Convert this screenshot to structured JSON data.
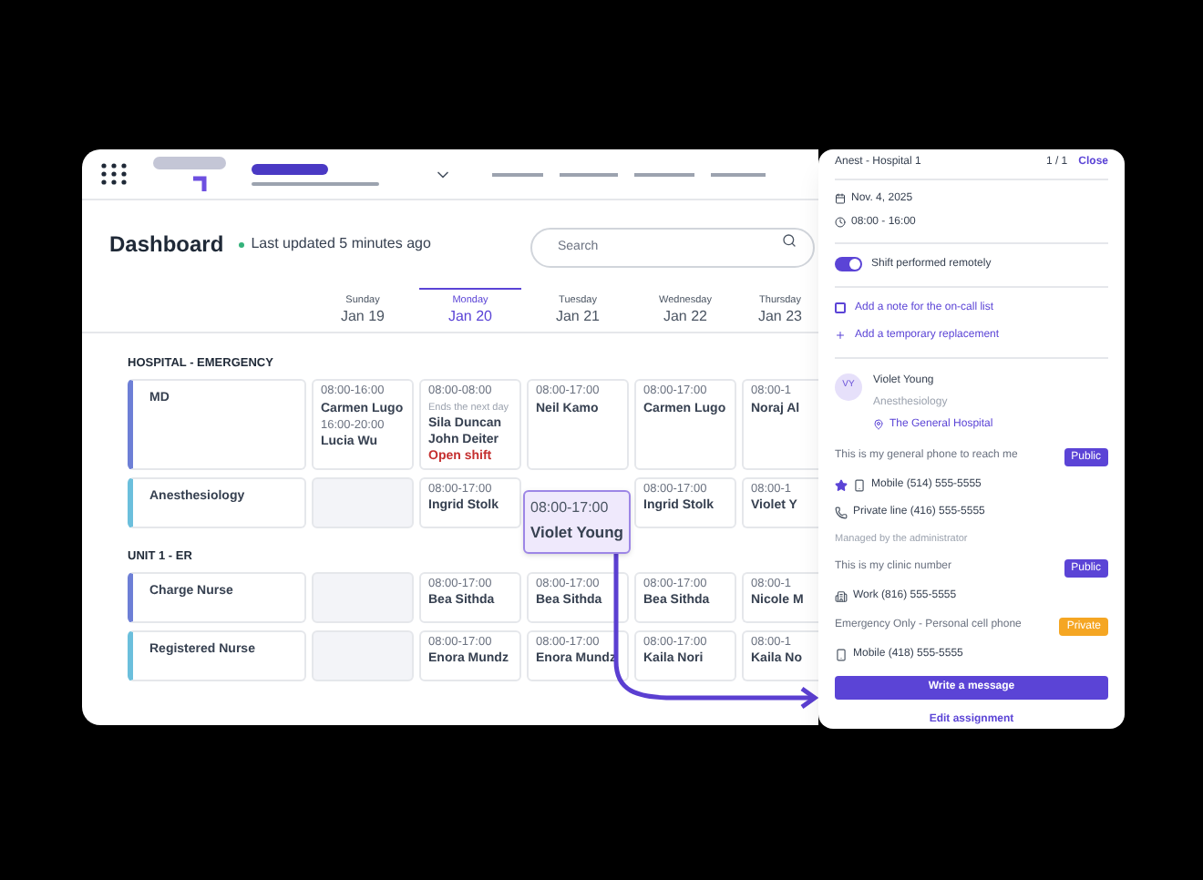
{
  "dashboard": {
    "title": "Dashboard",
    "status": "Last updated 5 minutes ago"
  },
  "search": {
    "placeholder": "Search"
  },
  "days": [
    {
      "weekday": "Sunday",
      "date": "Jan 19",
      "selected": false
    },
    {
      "weekday": "Monday",
      "date": "Jan 20",
      "selected": true
    },
    {
      "weekday": "Tuesday",
      "date": "Jan 21",
      "selected": false
    },
    {
      "weekday": "Wednesday",
      "date": "Jan 22",
      "selected": false
    },
    {
      "weekday": "Thursday",
      "date": "Jan 23",
      "selected": false
    }
  ],
  "sections": [
    {
      "title": "HOSPITAL - EMERGENCY",
      "rows": [
        {
          "label": "MD",
          "color": "#6d7fd6",
          "cells": [
            {
              "kind": "shifts",
              "shifts": [
                {
                  "time": "08:00-16:00",
                  "people": [
                    {
                      "kind": "person",
                      "name": "Carmen Lugo"
                    }
                  ]
                },
                {
                  "time": "16:00-20:00",
                  "people": [
                    {
                      "kind": "person",
                      "name": "Lucia Wu"
                    }
                  ]
                }
              ]
            },
            {
              "kind": "shifts",
              "shifts": [
                {
                  "time": "08:00-08:00",
                  "note": "Ends the next day",
                  "people": [
                    {
                      "kind": "person",
                      "name": "Sila Duncan"
                    },
                    {
                      "kind": "person",
                      "name": "John Deiter"
                    },
                    {
                      "kind": "open",
                      "name": "Open shift"
                    }
                  ]
                }
              ]
            },
            {
              "kind": "shifts",
              "shifts": [
                {
                  "time": "08:00-17:00",
                  "people": [
                    {
                      "kind": "person",
                      "name": "Neil Kamo"
                    }
                  ]
                }
              ]
            },
            {
              "kind": "shifts",
              "shifts": [
                {
                  "time": "08:00-17:00",
                  "people": [
                    {
                      "kind": "person",
                      "name": "Carmen Lugo"
                    }
                  ]
                }
              ]
            },
            {
              "kind": "shifts",
              "shifts": [
                {
                  "time": "08:00-1",
                  "people": [
                    {
                      "kind": "person",
                      "name": "Noraj Al"
                    }
                  ]
                }
              ]
            }
          ]
        },
        {
          "label": "Anesthesiology",
          "color": "#6bbfdc",
          "cells": [
            {
              "kind": "empty"
            },
            {
              "kind": "shifts",
              "shifts": [
                {
                  "time": "08:00-17:00",
                  "people": [
                    {
                      "kind": "person",
                      "name": "Ingrid Stolk"
                    }
                  ]
                }
              ]
            },
            {
              "kind": "hidden"
            },
            {
              "kind": "shifts",
              "shifts": [
                {
                  "time": "08:00-17:00",
                  "people": [
                    {
                      "kind": "person",
                      "name": "Ingrid Stolk"
                    }
                  ]
                }
              ]
            },
            {
              "kind": "shifts",
              "shifts": [
                {
                  "time": "08:00-1",
                  "people": [
                    {
                      "kind": "person",
                      "name": "Violet Y"
                    }
                  ]
                }
              ]
            }
          ]
        }
      ]
    },
    {
      "title": "UNIT 1 - ER",
      "rows": [
        {
          "label": "Charge Nurse",
          "color": "#6d7fd6",
          "cells": [
            {
              "kind": "empty"
            },
            {
              "kind": "shifts",
              "shifts": [
                {
                  "time": "08:00-17:00",
                  "people": [
                    {
                      "kind": "person",
                      "name": "Bea Sithda"
                    }
                  ]
                }
              ]
            },
            {
              "kind": "shifts",
              "shifts": [
                {
                  "time": "08:00-17:00",
                  "people": [
                    {
                      "kind": "person",
                      "name": "Bea Sithda"
                    }
                  ]
                }
              ]
            },
            {
              "kind": "shifts",
              "shifts": [
                {
                  "time": "08:00-17:00",
                  "people": [
                    {
                      "kind": "person",
                      "name": "Bea Sithda"
                    }
                  ]
                }
              ]
            },
            {
              "kind": "shifts",
              "shifts": [
                {
                  "time": "08:00-1",
                  "people": [
                    {
                      "kind": "person",
                      "name": "Nicole M"
                    }
                  ]
                }
              ]
            }
          ]
        },
        {
          "label": "Registered Nurse",
          "color": "#6bbfdc",
          "cells": [
            {
              "kind": "empty"
            },
            {
              "kind": "shifts",
              "shifts": [
                {
                  "time": "08:00-17:00",
                  "people": [
                    {
                      "kind": "person",
                      "name": "Enora Mundz"
                    }
                  ]
                }
              ]
            },
            {
              "kind": "shifts",
              "shifts": [
                {
                  "time": "08:00-17:00",
                  "people": [
                    {
                      "kind": "person",
                      "name": "Enora Mundz"
                    }
                  ]
                }
              ]
            },
            {
              "kind": "shifts",
              "shifts": [
                {
                  "time": "08:00-17:00",
                  "people": [
                    {
                      "kind": "person",
                      "name": "Kaila Nori"
                    }
                  ]
                }
              ]
            },
            {
              "kind": "shifts",
              "shifts": [
                {
                  "time": "08:00-1",
                  "people": [
                    {
                      "kind": "person",
                      "name": "Kaila No"
                    }
                  ]
                }
              ]
            }
          ]
        }
      ]
    }
  ],
  "drag_card": {
    "time": "08:00-17:00",
    "name": "Violet Young"
  },
  "panel": {
    "title": "Anest - Hospital 1",
    "pager": "1 / 1",
    "close": "Close",
    "date": "Nov. 4, 2025",
    "time": "08:00 - 16:00",
    "remote": {
      "label": "Shift performed remotely",
      "on": true
    },
    "note": {
      "label": "Add a note for the on-call list",
      "checked": false
    },
    "replacement": "Add a temporary replacement",
    "person": {
      "initials": "VY",
      "name": "Violet Young",
      "role": "Anesthesiology",
      "location": "The General Hospital"
    },
    "contacts": [
      {
        "title": "This is my general phone to reach me",
        "badge": {
          "label": "Public",
          "kind": "public"
        },
        "lines": [
          {
            "kind": "mobile",
            "label": "Mobile",
            "number": "(514) 555-5555",
            "favorite": true
          },
          {
            "kind": "landline",
            "label": "Private line",
            "number": "(416) 555-5555",
            "favorite": false
          }
        ],
        "note": "Managed by the administrator"
      },
      {
        "title": "This is my clinic number",
        "badge": {
          "label": "Public",
          "kind": "public"
        },
        "lines": [
          {
            "kind": "work",
            "label": "Work",
            "number": "(816) 555-5555",
            "favorite": false
          }
        ]
      },
      {
        "title": "Emergency Only - Personal cell phone",
        "badge": {
          "label": "Private",
          "kind": "private"
        },
        "lines": [
          {
            "kind": "mobile",
            "label": "Mobile",
            "number": "(418) 555-5555",
            "favorite": false
          }
        ]
      }
    ],
    "primary_button": "Write a message",
    "link": "Edit assignment"
  }
}
